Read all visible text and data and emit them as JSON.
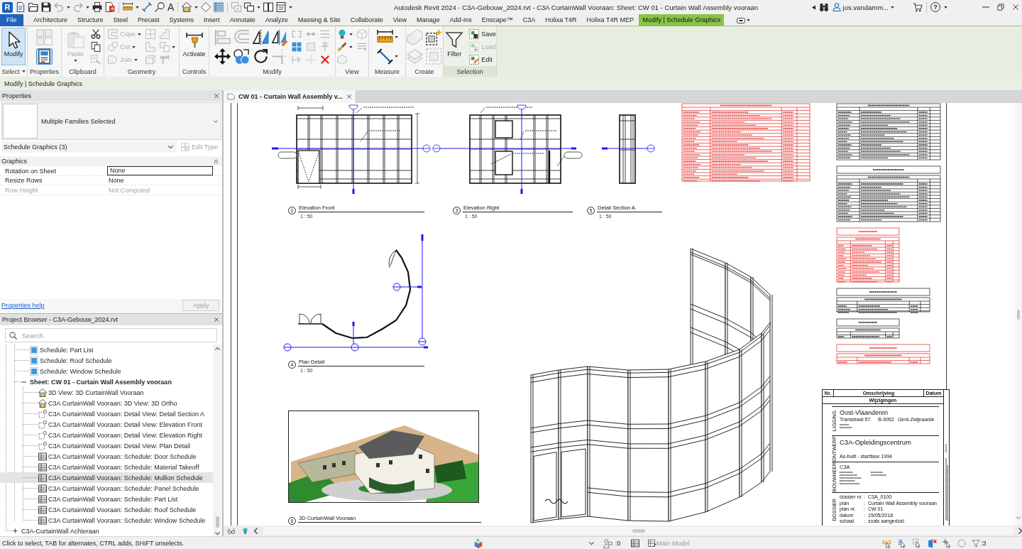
{
  "window": {
    "title": "Autodesk Revit 2024 - C3A-Gebouw_2024.rvt - C3A CurtainWall Vooraan: Sheet: CW 01 - Curtain Wall Assembly vooraan",
    "user": "jos.vandamm...",
    "help_glyph": "?"
  },
  "quick_access": [
    {
      "kind": "app",
      "glyph": "R"
    },
    {
      "kind": "button",
      "disabled": false,
      "menu": false,
      "on": false
    },
    {
      "kind": "button",
      "disabled": false,
      "menu": false,
      "on": false
    },
    {
      "kind": "button",
      "disabled": false,
      "menu": false,
      "on": false
    },
    {
      "kind": "button",
      "disabled": true,
      "menu": true,
      "on": false
    },
    {
      "kind": "button",
      "disabled": true,
      "menu": true,
      "on": false
    },
    {
      "kind": "button",
      "disabled": false,
      "menu": false,
      "on": false
    },
    {
      "kind": "button",
      "disabled": false,
      "menu": false,
      "on": false
    },
    {
      "kind": "separator"
    },
    {
      "kind": "button",
      "disabled": false,
      "menu": true,
      "on": false
    },
    {
      "kind": "button",
      "disabled": false,
      "menu": false,
      "on": false
    },
    {
      "kind": "button",
      "disabled": false,
      "menu": false,
      "on": false
    },
    {
      "kind": "glyph",
      "glyph": "A"
    },
    {
      "kind": "separator"
    },
    {
      "kind": "button",
      "disabled": false,
      "menu": true,
      "on": false
    },
    {
      "kind": "button",
      "disabled": false,
      "menu": false,
      "on": false
    },
    {
      "kind": "button",
      "disabled": false,
      "menu": false,
      "on": true
    },
    {
      "kind": "separator"
    },
    {
      "kind": "button",
      "disabled": true,
      "menu": false,
      "on": false
    },
    {
      "kind": "button",
      "disabled": false,
      "menu": true,
      "on": false
    },
    {
      "kind": "button",
      "disabled": false,
      "menu": false,
      "on": false
    },
    {
      "kind": "button",
      "disabled": false,
      "menu": false,
      "on": false
    },
    {
      "kind": "menu"
    }
  ],
  "ribbon_tabs": [
    {
      "label": "File",
      "kind": "file",
      "selected": false
    },
    {
      "label": "Architecture",
      "kind": "tab",
      "selected": false
    },
    {
      "label": "Structure",
      "kind": "tab",
      "selected": false
    },
    {
      "label": "Steel",
      "kind": "tab",
      "selected": false
    },
    {
      "label": "Precast",
      "kind": "tab",
      "selected": false
    },
    {
      "label": "Systems",
      "kind": "tab",
      "selected": false
    },
    {
      "label": "Insert",
      "kind": "tab",
      "selected": false
    },
    {
      "label": "Annotate",
      "kind": "tab",
      "selected": false
    },
    {
      "label": "Analyze",
      "kind": "tab",
      "selected": false
    },
    {
      "label": "Massing & Site",
      "kind": "tab",
      "selected": false
    },
    {
      "label": "Collaborate",
      "kind": "tab",
      "selected": false
    },
    {
      "label": "View",
      "kind": "tab",
      "selected": false
    },
    {
      "label": "Manage",
      "kind": "tab",
      "selected": false
    },
    {
      "label": "Add-Ins",
      "kind": "tab",
      "selected": false
    },
    {
      "label": "Enscape™",
      "kind": "tab",
      "selected": false
    },
    {
      "label": "C3A",
      "kind": "tab",
      "selected": false
    },
    {
      "label": "Holixa T4R",
      "kind": "tab",
      "selected": false
    },
    {
      "label": "Holixa T4R MEP",
      "kind": "tab",
      "selected": false
    },
    {
      "label": "Modify | Schedule Graphics",
      "kind": "contextual",
      "selected": true
    }
  ],
  "ribbon_panels": [
    {
      "label": "Select",
      "menu": true,
      "contextual": false,
      "tools": [
        {
          "label": "Modify",
          "kind": "large",
          "disabled": false,
          "on": true,
          "menu": false
        }
      ]
    },
    {
      "label": "Properties",
      "menu": false,
      "contextual": false,
      "tools": [
        {
          "kind": "medium",
          "disabled": true,
          "on": false,
          "menu": false
        },
        {
          "kind": "medium",
          "disabled": false,
          "on": true,
          "menu": false
        }
      ]
    },
    {
      "label": "Clipboard",
      "menu": false,
      "contextual": false,
      "tools": [
        {
          "label": "Paste",
          "kind": "large",
          "disabled": true,
          "on": false,
          "menu": true
        },
        {
          "kind": "small",
          "disabled": false,
          "on": false,
          "menu": false
        },
        {
          "kind": "small",
          "disabled": false,
          "on": false,
          "menu": false
        },
        {
          "kind": "small",
          "disabled": true,
          "on": false,
          "menu": false
        }
      ]
    },
    {
      "label": "Geometry",
      "menu": false,
      "contextual": false,
      "tools": [
        {
          "label": "Cope",
          "kind": "small",
          "disabled": true,
          "on": false,
          "menu": true
        },
        {
          "label": "Cut",
          "kind": "small",
          "disabled": true,
          "on": false,
          "menu": true
        },
        {
          "label": "Join",
          "kind": "small",
          "disabled": true,
          "on": false,
          "menu": true
        },
        {
          "kind": "small",
          "disabled": true,
          "on": false,
          "menu": false
        },
        {
          "kind": "small",
          "disabled": true,
          "on": false,
          "menu": false
        },
        {
          "kind": "small",
          "disabled": true,
          "on": false,
          "menu": false
        },
        {
          "kind": "small",
          "disabled": true,
          "on": false,
          "menu": false
        },
        {
          "kind": "small",
          "disabled": true,
          "on": false,
          "menu": true
        },
        {
          "kind": "small",
          "disabled": true,
          "on": false,
          "menu": false
        }
      ]
    },
    {
      "label": "Controls",
      "menu": false,
      "contextual": false,
      "tools": [
        {
          "label": "Activate",
          "kind": "large",
          "disabled": false,
          "on": false,
          "menu": false
        }
      ]
    },
    {
      "label": "Modify",
      "menu": false,
      "contextual": false,
      "tools": [
        {
          "kind": "medium",
          "disabled": true,
          "on": false,
          "menu": false
        },
        {
          "kind": "medium",
          "disabled": false,
          "on": false,
          "menu": false
        },
        {
          "kind": "medium",
          "disabled": true,
          "on": false,
          "menu": false
        },
        {
          "kind": "medium",
          "disabled": false,
          "on": false,
          "menu": false
        },
        {
          "kind": "medium",
          "disabled": false,
          "on": false,
          "menu": false
        },
        {
          "kind": "medium",
          "disabled": false,
          "on": false,
          "menu": false
        },
        {
          "kind": "medium",
          "disabled": false,
          "on": false,
          "menu": false
        },
        {
          "kind": "medium",
          "disabled": true,
          "on": false,
          "menu": false
        },
        {
          "kind": "small",
          "disabled": true,
          "on": false,
          "menu": false
        },
        {
          "kind": "small",
          "disabled": false,
          "on": false,
          "menu": false
        },
        {
          "kind": "small",
          "disabled": true,
          "on": false,
          "menu": false
        },
        {
          "kind": "small",
          "disabled": true,
          "on": false,
          "menu": false
        },
        {
          "kind": "small",
          "disabled": true,
          "on": false,
          "menu": false
        },
        {
          "kind": "small",
          "disabled": true,
          "on": false,
          "menu": false
        },
        {
          "kind": "small",
          "disabled": true,
          "on": false,
          "menu": false
        },
        {
          "kind": "small",
          "disabled": true,
          "on": false,
          "menu": false
        },
        {
          "kind": "small",
          "disabled": false,
          "on": false,
          "menu": false
        }
      ]
    },
    {
      "label": "View",
      "menu": false,
      "contextual": false,
      "tools": [
        {
          "kind": "small",
          "disabled": false,
          "on": false,
          "menu": true
        },
        {
          "kind": "small",
          "disabled": false,
          "on": false,
          "menu": true
        },
        {
          "kind": "small",
          "disabled": true,
          "on": false,
          "menu": false
        },
        {
          "kind": "small",
          "disabled": true,
          "on": false,
          "menu": false
        },
        {
          "kind": "small",
          "disabled": true,
          "on": false,
          "menu": false
        }
      ]
    },
    {
      "label": "Measure",
      "menu": false,
      "contextual": false,
      "tools": [
        {
          "kind": "medium",
          "disabled": false,
          "on": false,
          "menu": true
        },
        {
          "kind": "medium",
          "disabled": false,
          "on": false,
          "menu": true
        }
      ]
    },
    {
      "label": "Create",
      "menu": false,
      "contextual": false,
      "tools": [
        {
          "kind": "medium",
          "disabled": true,
          "on": false,
          "menu": false
        },
        {
          "kind": "medium",
          "disabled": true,
          "on": false,
          "menu": false
        },
        {
          "kind": "medium",
          "disabled": false,
          "on": false,
          "menu": false
        },
        {
          "kind": "medium",
          "disabled": true,
          "on": false,
          "menu": false
        }
      ]
    },
    {
      "label": "Selection",
      "menu": false,
      "contextual": true,
      "tools": [
        {
          "label": "Filter",
          "kind": "large",
          "disabled": false,
          "on": false,
          "menu": false
        },
        {
          "label": "Save",
          "kind": "small",
          "disabled": false,
          "on": false,
          "menu": false
        },
        {
          "label": "Load",
          "kind": "small",
          "disabled": true,
          "on": false,
          "menu": false
        },
        {
          "label": "Edit",
          "kind": "small",
          "disabled": false,
          "on": false,
          "menu": false
        }
      ]
    }
  ],
  "options_bar": {
    "context": "Modify | Schedule Graphics"
  },
  "properties": {
    "title": "Properties",
    "type_name": "Multiple Families Selected",
    "instance_filter": "Schedule Graphics (3)",
    "edit_type": {
      "label": "Edit Type",
      "disabled": true
    },
    "groups": [
      {
        "label": "Graphics",
        "expanded": true,
        "rows": [
          {
            "name": "Rotation on Sheet",
            "value": "None",
            "editing": true,
            "disabled": false
          },
          {
            "name": "Resize Rows",
            "value": "None",
            "editing": false,
            "disabled": false
          },
          {
            "name": "Row Height",
            "value": "Not Computed",
            "editing": false,
            "disabled": true
          }
        ]
      }
    ],
    "help": "Properties help",
    "apply": {
      "label": "Apply",
      "disabled": true
    }
  },
  "project_browser": {
    "title": "Project Browser - C3A-Gebouw_2024.rvt",
    "search": {
      "placeholder": "Search"
    },
    "tree": [
      {
        "kind": "offscreen",
        "children": [
          {
            "label": "Schedule: Part List",
            "kind": "schedule",
            "selected": false
          },
          {
            "label": "Schedule: Roof Schedule",
            "kind": "schedule",
            "selected": false
          },
          {
            "label": "Schedule: Window Schedule",
            "kind": "schedule",
            "selected": false
          },
          {
            "label": "Sheet: CW 01 - Curtain Wall Assembly vooraan",
            "kind": "sheet",
            "expanded": true,
            "selected": false,
            "children": [
              {
                "label": "3D View: 3D CurtainWall Vooraan",
                "kind": "model",
                "selected": false
              },
              {
                "label": "C3A CurtainWall Vooraan: 3D View: 3D Ortho",
                "kind": "model",
                "selected": false
              },
              {
                "label": "C3A CurtainWall Vooraan: Detail View: Detail Section A",
                "kind": "detail",
                "selected": false
              },
              {
                "label": "C3A CurtainWall Vooraan: Detail View: Elevation Front",
                "kind": "detail",
                "selected": false
              },
              {
                "label": "C3A CurtainWall Vooraan: Detail View: Elevation Right",
                "kind": "detail",
                "selected": false
              },
              {
                "label": "C3A CurtainWall Vooraan: Detail View: Plan Detail",
                "kind": "detail",
                "selected": false
              },
              {
                "label": "C3A CurtainWall Vooraan: Schedule: Door Schedule",
                "kind": "table",
                "selected": false
              },
              {
                "label": "C3A CurtainWall Vooraan: Schedule: Material Takeoff",
                "kind": "table",
                "selected": false
              },
              {
                "label": "C3A CurtainWall Vooraan: Schedule: Mullion Schedule",
                "kind": "table",
                "selected": true
              },
              {
                "label": "C3A CurtainWall Vooraan: Schedule: Panel Schedule",
                "kind": "table",
                "selected": false
              },
              {
                "label": "C3A CurtainWall Vooraan: Schedule: Part List",
                "kind": "table",
                "selected": false
              },
              {
                "label": "C3A CurtainWall Vooraan: Schedule: Roof Schedule",
                "kind": "table",
                "selected": false
              },
              {
                "label": "C3A CurtainWall Vooraan: Schedule: Window Schedule",
                "kind": "table",
                "selected": false
              }
            ]
          }
        ]
      },
      {
        "label": "C3A-CurtainWall Achteraan",
        "kind": "group",
        "expanded": false,
        "selected": false
      }
    ]
  },
  "view_tab": {
    "label": "CW 01 - Curtain Wall Assembly v..."
  },
  "sheet": {
    "views": [
      {
        "number": "2",
        "title": "Elevation Front",
        "scale": "1 : 50"
      },
      {
        "number": "3",
        "title": "Elevation Right",
        "scale": "1 : 50"
      },
      {
        "number": "5",
        "title": "Detail Section A",
        "scale": "1 : 50"
      },
      {
        "number": "4",
        "title": "Plan Detail",
        "scale": "1 : 50"
      },
      {
        "number": "6",
        "title": "3D CurtainWall Vooraan"
      }
    ],
    "schedules": [
      {
        "selected": true
      },
      {
        "selected": false
      },
      {
        "selected": false
      },
      {
        "selected": true
      },
      {
        "selected": false
      },
      {
        "selected": false
      },
      {
        "selected": true
      }
    ],
    "title_block": {
      "revisions": {
        "columns": [
          "Nr.",
          "Omschrijving",
          "Datum"
        ],
        "caption": "Wijzigingen"
      },
      "location": {
        "label": "LIGGING",
        "name": "Oost-Vlaanderen",
        "street": "Tramstraat 57",
        "postcode": "B-9052",
        "city": "Gent-Zwijnaarde"
      },
      "project": {
        "label": "ONTWERP",
        "name": "C3A-Opleidingscentrum",
        "phase": "As-built - startfase 1994"
      },
      "client": {
        "label": "BOUWHEER",
        "name": "C3A"
      },
      "dossier": {
        "label": "DOSSIER",
        "separator": ":",
        "fields": [
          {
            "name": "dossier nr.",
            "value": "C3A_0100"
          },
          {
            "name": "plan",
            "value": "Curtain Wall Assembly vooraan"
          },
          {
            "name": "plan nr.",
            "value": "CW 01"
          },
          {
            "name": "datum",
            "value": "15/05/2018"
          },
          {
            "name": "schaal",
            "value": "zoals aangeduid"
          }
        ]
      }
    }
  },
  "status_bar": {
    "message": "Click to select, TAB for alternates, CTRL adds, SHIFT unselects.",
    "count": ":0",
    "design_option": {
      "label": "Main Model",
      "disabled": true
    },
    "filter_count": ":3"
  }
}
